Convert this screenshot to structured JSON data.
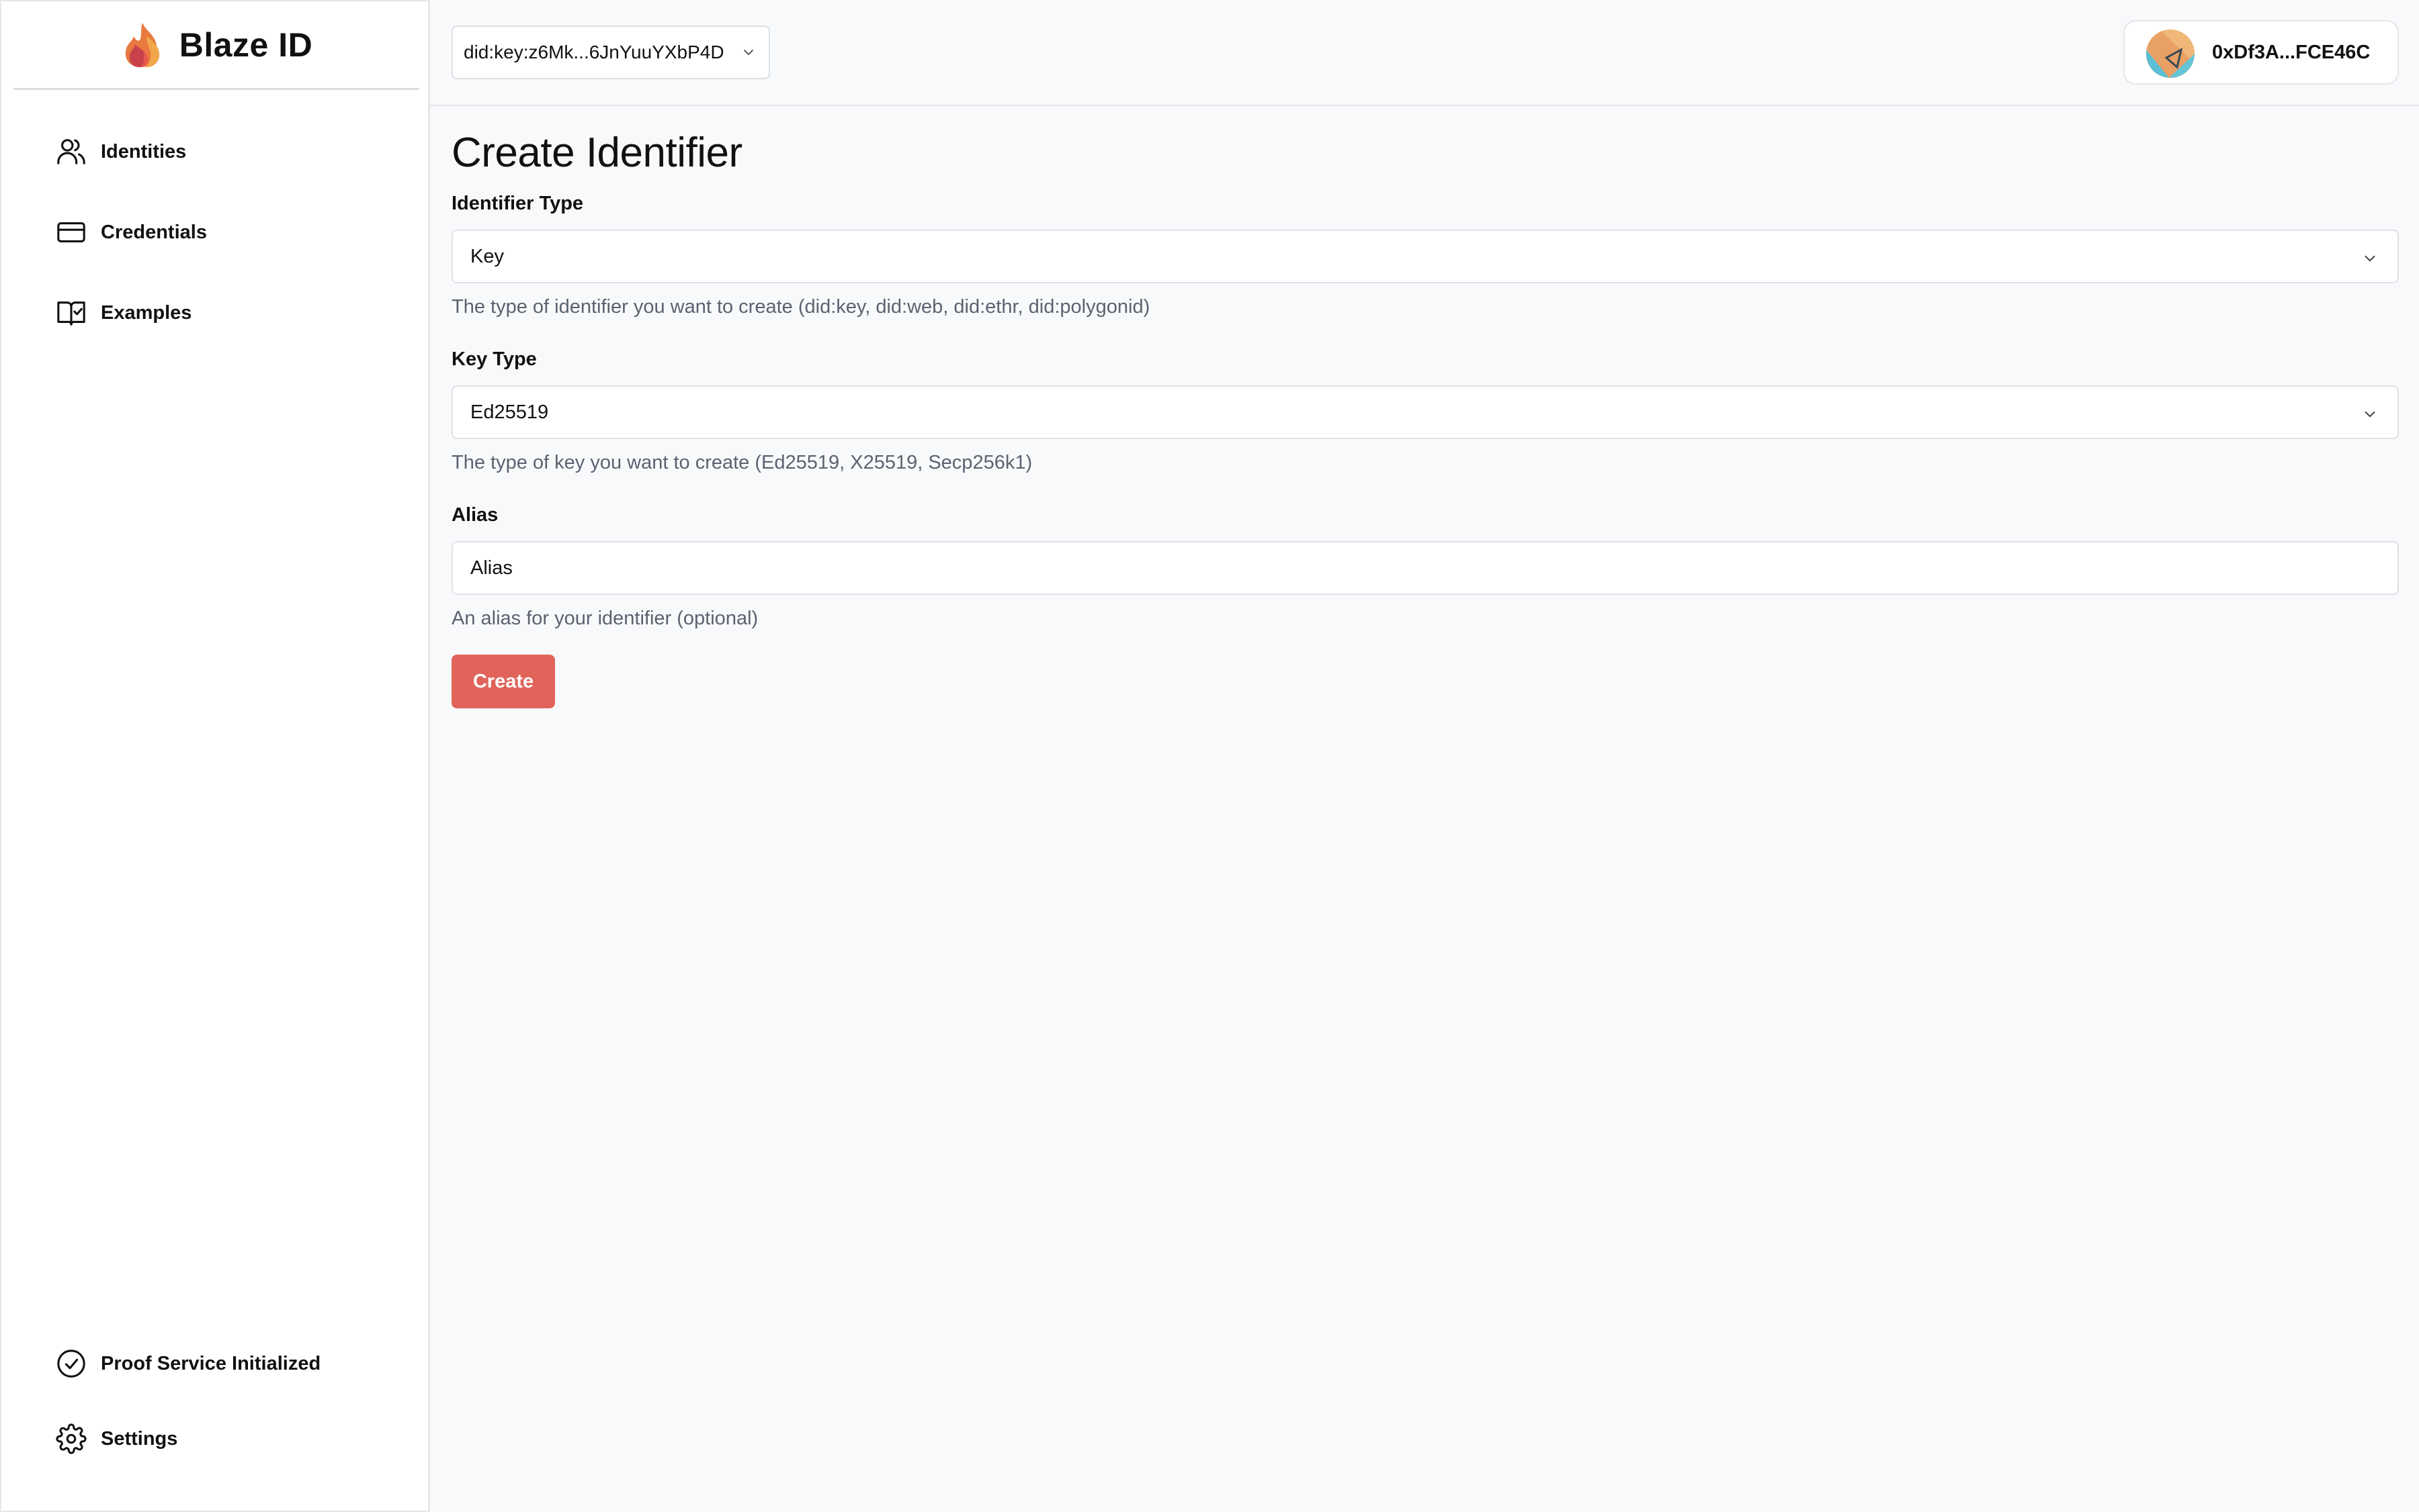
{
  "brand": {
    "name": "Blaze ID"
  },
  "sidebar": {
    "items": [
      {
        "label": "Identities",
        "icon": "users-icon"
      },
      {
        "label": "Credentials",
        "icon": "credit-card-icon"
      },
      {
        "label": "Examples",
        "icon": "book-check-icon"
      }
    ],
    "footer": [
      {
        "label": "Proof Service Initialized",
        "icon": "check-circle-icon"
      },
      {
        "label": "Settings",
        "icon": "gear-icon"
      }
    ]
  },
  "topbar": {
    "did_selector": "did:key:z6Mk...6JnYuuYXbP4D",
    "account_address": "0xDf3A...FCE46C"
  },
  "form": {
    "title": "Create Identifier",
    "identifier_type": {
      "label": "Identifier Type",
      "value": "Key",
      "help": "The type of identifier you want to create (did:key, did:web, did:ethr, did:polygonid)"
    },
    "key_type": {
      "label": "Key Type",
      "value": "Ed25519",
      "help": "The type of key you want to create (Ed25519, X25519, Secp256k1)"
    },
    "alias": {
      "label": "Alias",
      "placeholder": "Alias",
      "help": "An alias for your identifier (optional)"
    },
    "submit_label": "Create"
  },
  "colors": {
    "accent": "#e0645a",
    "sidebar_bg": "#ffffff",
    "page_bg": "#f8f9fb",
    "help_text": "#5b6270"
  }
}
